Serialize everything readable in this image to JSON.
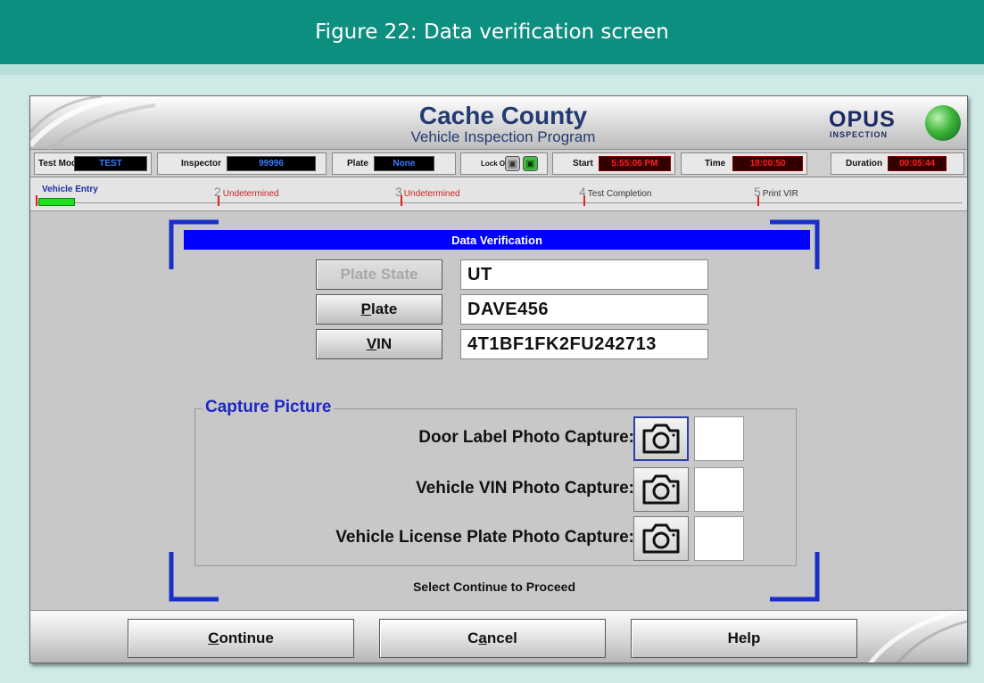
{
  "figure": {
    "caption": "Figure 22: Data verification screen"
  },
  "banner": {
    "title": "Cache County",
    "subtitle": "Vehicle Inspection Program",
    "logo_text": "OPUS",
    "logo_subtext": "INSPECTION"
  },
  "status": {
    "test_mode_label": "Test Mode",
    "test_mode_value": "TEST",
    "inspector_label": "Inspector",
    "inspector_value": "99996",
    "plate_label": "Plate",
    "plate_value": "None",
    "lockout_label": "Lock Out",
    "start_label": "Start",
    "start_value": "5:55:06 PM",
    "time_label": "Time",
    "time_value": "18:00:50",
    "duration_label": "Duration",
    "duration_value": "00:05:44"
  },
  "progress": {
    "fill_fraction": 0.2,
    "steps": [
      {
        "num": "",
        "label": "Vehicle Entry",
        "state": "active"
      },
      {
        "num": "2",
        "label": "Undetermined",
        "state": "pending"
      },
      {
        "num": "3",
        "label": "Undetermined",
        "state": "pending"
      },
      {
        "num": "4",
        "label": "Test Completion",
        "state": "neutral"
      },
      {
        "num": "5",
        "label": "Print VIR",
        "state": "neutral"
      }
    ]
  },
  "panel": {
    "title": "Data Verification",
    "fields": [
      {
        "button": "Plate State",
        "value": "UT",
        "enabled": false
      },
      {
        "button_underline": "P",
        "button_rest": "late",
        "value": "DAVE456",
        "enabled": true
      },
      {
        "button_underline": "V",
        "button_rest": "IN",
        "value": "4T1BF1FK2FU242713",
        "enabled": true
      }
    ],
    "capture": {
      "legend": "Capture Picture",
      "rows": [
        {
          "label": "Door Label Photo Capture:"
        },
        {
          "label": "Vehicle VIN Photo Capture:"
        },
        {
          "label": "Vehicle License Plate Photo Capture:"
        }
      ]
    },
    "proceed_text": "Select Continue to Proceed"
  },
  "buttons": {
    "continue_underline": "C",
    "continue_rest": "ontinue",
    "cancel_pre": "C",
    "cancel_underline": "a",
    "cancel_rest": "ncel",
    "help": "Help"
  },
  "colors": {
    "header": "#0d8f80",
    "panel_title": "#0000ff",
    "accent_text": "#1f26c9",
    "progress_fill": "#1ede1e"
  }
}
